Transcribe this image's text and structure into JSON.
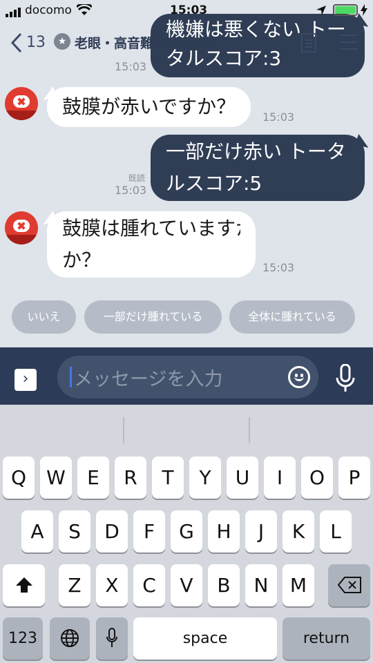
{
  "status_bar": {
    "carrier": "docomo",
    "time": "15:03"
  },
  "header": {
    "back_count": "13",
    "title": "老眼・高音難聴判定Bot"
  },
  "messages": [
    {
      "from": "user",
      "text": "機嫌は悪くない トータルスコア:3",
      "time": "15:03"
    },
    {
      "from": "bot",
      "text": "鼓膜が赤いですか？",
      "time": "15:03"
    },
    {
      "from": "user",
      "text_line1": "一部だけ赤い トータ",
      "text_line2": "ルスコア:5",
      "read": "既読",
      "time": "15:03"
    },
    {
      "from": "bot",
      "text_line1": "鼓膜は腫れていますか",
      "text_line2": "か？",
      "time": "15:03"
    }
  ],
  "quick_replies": [
    "いいえ",
    "一部だけ腫れている",
    "全体に腫れている"
  ],
  "input": {
    "placeholder": "メッセージを入力"
  },
  "keyboard": {
    "row1": [
      "Q",
      "W",
      "E",
      "R",
      "T",
      "Y",
      "U",
      "I",
      "O",
      "P"
    ],
    "row2": [
      "A",
      "S",
      "D",
      "F",
      "G",
      "H",
      "J",
      "K",
      "L"
    ],
    "row3": [
      "Z",
      "X",
      "C",
      "V",
      "B",
      "N",
      "M"
    ],
    "numbers": "123",
    "space": "space",
    "return": "return"
  }
}
